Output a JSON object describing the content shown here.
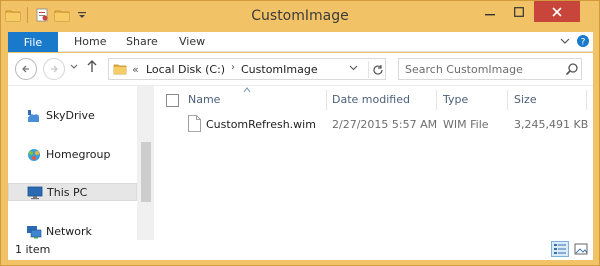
{
  "window": {
    "title": "CustomImage",
    "accent": "#f2c266",
    "close_color": "#c7453a"
  },
  "quick_access": {
    "icons": [
      "folder-icon",
      "properties-icon",
      "new-folder-icon",
      "customize-dropdown-icon"
    ]
  },
  "ribbon": {
    "tabs": [
      {
        "label": "File",
        "active": true,
        "color": "#1979ca"
      },
      {
        "label": "Home"
      },
      {
        "label": "Share"
      },
      {
        "label": "View"
      }
    ]
  },
  "address_bar": {
    "overflow": "«",
    "crumbs": [
      "Local Disk (C:)",
      "CustomImage"
    ],
    "separator": "›"
  },
  "search": {
    "placeholder": "Search CustomImage"
  },
  "nav_pane": {
    "items": [
      {
        "label": "SkyDrive",
        "icon": "cloud-icon"
      },
      {
        "label": "Homegroup",
        "icon": "homegroup-icon"
      },
      {
        "label": "This PC",
        "icon": "computer-icon",
        "selected": true
      },
      {
        "label": "Network",
        "icon": "network-icon"
      }
    ]
  },
  "file_list": {
    "sort_column": "Name",
    "columns": [
      "Name",
      "Date modified",
      "Type",
      "Size"
    ],
    "rows": [
      {
        "name": "CustomRefresh.wim",
        "date_modified": "2/27/2015 5:57 AM",
        "type": "WIM File",
        "size": "3,245,491 KB",
        "icon": "file-icon"
      }
    ]
  },
  "status_bar": {
    "item_count": "1 item",
    "view_modes": [
      "details-view-icon",
      "large-icons-view-icon"
    ],
    "active_view": "details-view-icon"
  }
}
